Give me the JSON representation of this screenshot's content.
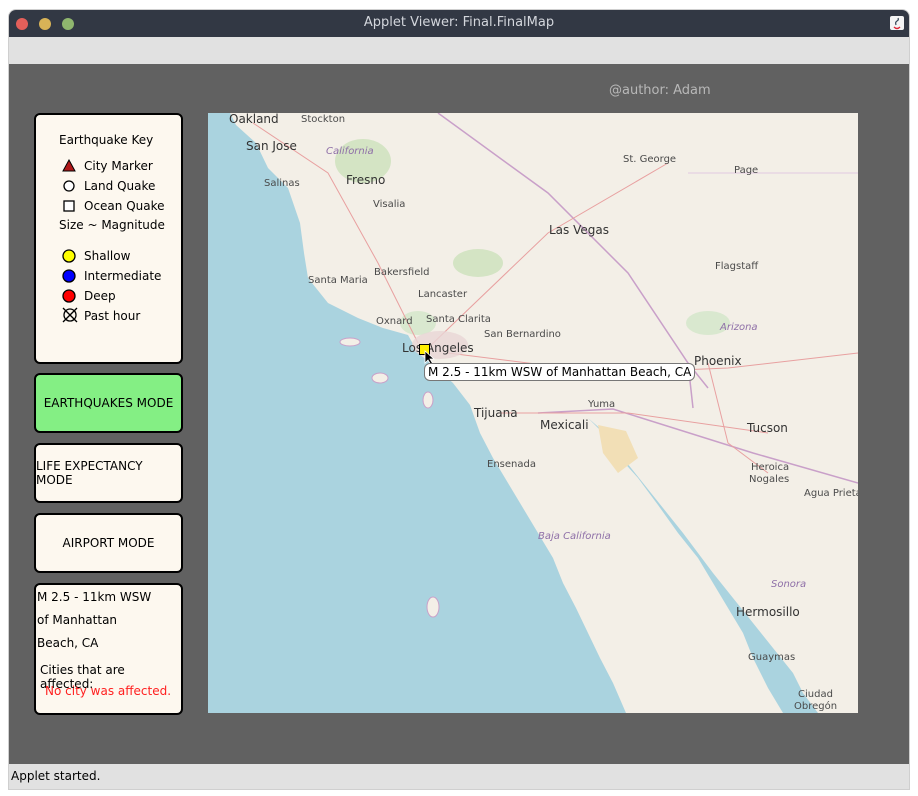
{
  "window": {
    "title": "Applet Viewer: Final.FinalMap",
    "status": "Applet started."
  },
  "author": "@author: Adam",
  "key": {
    "title": "Earthquake Key",
    "items": [
      {
        "label": "City Marker",
        "icon": "triangle-icon"
      },
      {
        "label": "Land Quake",
        "icon": "circle-icon"
      },
      {
        "label": "Ocean Quake",
        "icon": "square-icon"
      }
    ],
    "size_label": "Size ~ Magnitude",
    "depth": [
      {
        "label": "Shallow",
        "color": "#ffff00"
      },
      {
        "label": "Intermediate",
        "color": "#0000ff"
      },
      {
        "label": "Deep",
        "color": "#ff0000"
      },
      {
        "label": "Past hour",
        "icon": "crossed-circle-icon"
      }
    ]
  },
  "modes": {
    "earthquakes": "EARTHQUAKES MODE",
    "life": "LIFE EXPECTANCY MODE",
    "airport": "AIRPORT MODE",
    "active_color": "#84ef84"
  },
  "info": {
    "lines": [
      "M 2.5 - 11km WSW",
      "of Manhattan",
      "Beach, CA"
    ],
    "cities_label": "Cities that are affected:",
    "none_label": "No city was affected.",
    "none_color": "#ff2020"
  },
  "map": {
    "tooltip": "M 2.5 - 11km WSW of Manhattan Beach, CA",
    "cities": [
      "Oakland",
      "Stockton",
      "San Jose",
      "California",
      "Salinas",
      "Fresno",
      "Visalia",
      "St. George",
      "Page",
      "Las Vegas",
      "Bakersfield",
      "Santa Maria",
      "Lancaster",
      "Flagstaff",
      "Oxnard",
      "Santa Clarita",
      "San Bernardino",
      "Los Angeles",
      "Arizona",
      "Phoenix",
      "Tijuana",
      "Yuma",
      "Mexicali",
      "Tucson",
      "Ensenada",
      "Heroica",
      "Nogales",
      "Agua Prieta",
      "Baja California",
      "Sonora",
      "Hermosillo",
      "Guaymas",
      "Ciudad",
      "Obregón"
    ]
  }
}
